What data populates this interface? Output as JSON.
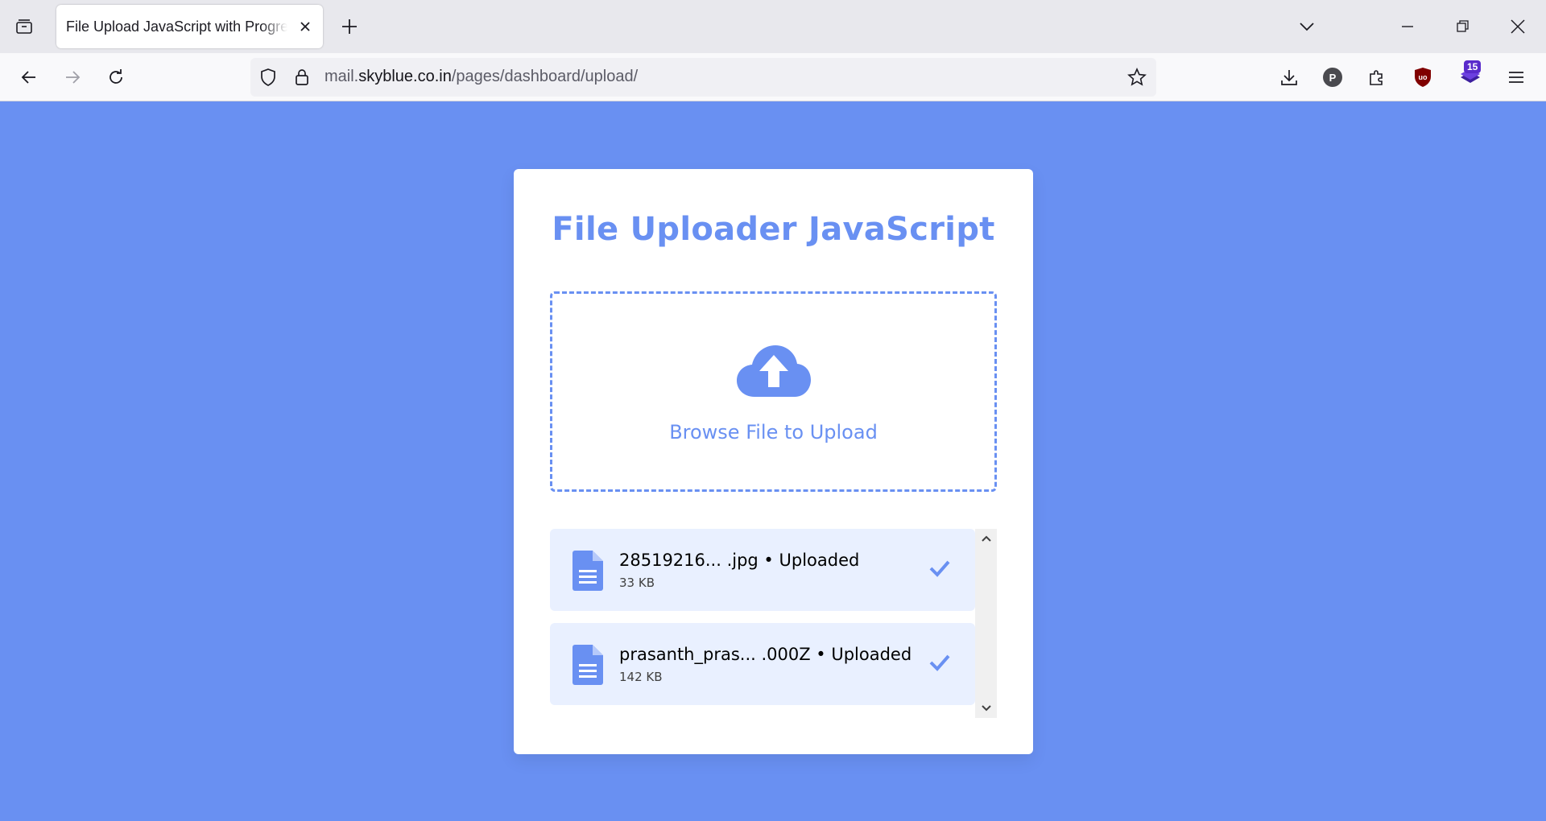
{
  "browser": {
    "tab_title": "File Upload JavaScript with Progress Bar",
    "url_scheme_host_prefix": "mail.",
    "url_host": "skyblue.co.in",
    "url_path": "/pages/dashboard/upload/",
    "extension_badge": "15",
    "profile_initial": "P"
  },
  "uploader": {
    "title": "File Uploader JavaScript",
    "browse_label": "Browse File to Upload",
    "files": [
      {
        "name": "28519216... .jpg • Uploaded",
        "size": "33 KB",
        "status": "uploaded"
      },
      {
        "name": "prasanth_pras... .000Z • Uploaded",
        "size": "142 KB",
        "status": "uploaded"
      }
    ]
  },
  "colors": {
    "page_background": "#6990f2",
    "accent": "#6990f2",
    "file_row_background": "#e9f0ff"
  },
  "icons": {
    "tab_list": "tab-list-icon",
    "close": "close-icon",
    "new_tab": "plus-icon",
    "back": "back-arrow-icon",
    "forward": "forward-arrow-icon",
    "reload": "reload-icon",
    "shield": "shield-icon",
    "lock": "lock-icon",
    "bookmark": "star-icon",
    "download": "download-icon",
    "extensions": "puzzle-icon",
    "ublock": "ublock-icon",
    "menu": "hamburger-icon",
    "upload": "cloud-upload-icon",
    "file": "file-document-icon",
    "check": "checkmark-icon"
  }
}
